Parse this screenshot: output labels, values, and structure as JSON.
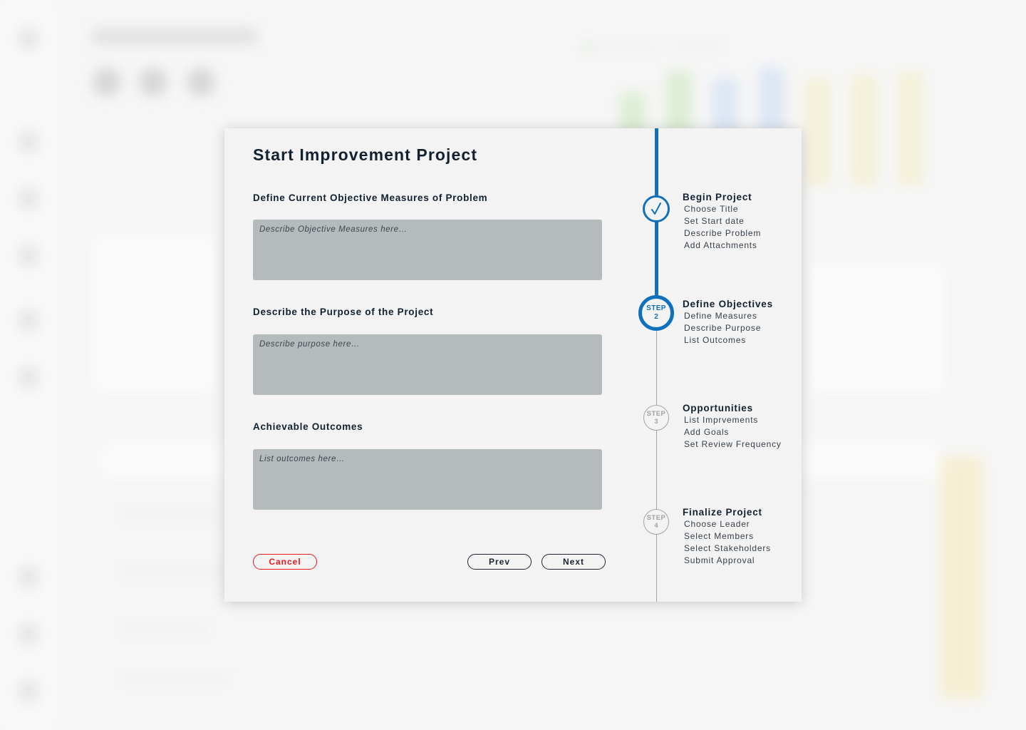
{
  "modal": {
    "title": "Start Improvement Project",
    "fields": [
      {
        "label": "Define Current Objective Measures of Problem",
        "value": "",
        "placeholder": "Describe Objective Measures here…"
      },
      {
        "label": "Describe the Purpose of the Project",
        "value": "",
        "placeholder": "Describe purpose here…"
      },
      {
        "label": "Achievable Outcomes",
        "value": "",
        "placeholder": "List outcomes here…"
      }
    ],
    "buttons": {
      "cancel": "Cancel",
      "prev": "Prev",
      "next": "Next"
    }
  },
  "steps": [
    {
      "status": "complete",
      "icon": "checkmark-icon",
      "title": "Begin Project",
      "items": [
        "Choose Title",
        "Set Start date",
        "Describe Problem",
        "Add Attachments"
      ]
    },
    {
      "status": "active",
      "word": "STEP",
      "number": "2",
      "title": "Define Objectives",
      "items": [
        "Define Measures",
        "Describe Purpose",
        "List Outcomes"
      ]
    },
    {
      "status": "upcoming",
      "word": "STEP",
      "number": "3",
      "title": "Opportunities",
      "items": [
        "List Imprvements",
        "Add Goals",
        "Set Review Frequency"
      ]
    },
    {
      "status": "upcoming",
      "word": "STEP",
      "number": "4",
      "title": "Finalize Project",
      "items": [
        "Choose Leader",
        "Select Members",
        "Select Stakeholders",
        "Submit Approval"
      ]
    }
  ],
  "colors": {
    "accent": "#1170bb",
    "danger": "#e21b1b",
    "text": "#122131",
    "field_bg": "#b5babc",
    "modal_bg": "#f3f3f3"
  }
}
